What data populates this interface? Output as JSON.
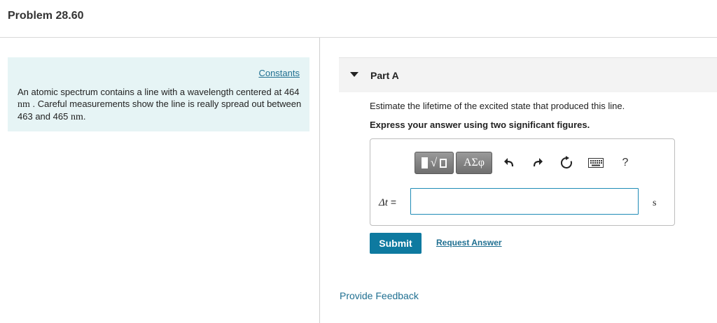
{
  "header": {
    "title": "Problem 28.60"
  },
  "constants": {
    "link": "Constants",
    "text_1": "An atomic spectrum contains a line with a wavelength centered at",
    "value_1": "464",
    "unit_1": "nm",
    "text_2": ". Careful measurements show the line is really spread out between",
    "value_2": "463",
    "text_3": "and",
    "value_3": "465",
    "unit_3": "nm",
    "text_4": "."
  },
  "part": {
    "label": "Part A",
    "question": "Estimate the lifetime of the excited state that produced this line.",
    "instruction": "Express your answer using two significant figures."
  },
  "toolbar": {
    "templates_icon": "templates-icon",
    "greek_label": "ΑΣφ",
    "undo_icon": "undo-icon",
    "redo_icon": "redo-icon",
    "reset_icon": "reset-icon",
    "keyboard_icon": "keyboard-icon",
    "help_label": "?"
  },
  "answer": {
    "variable": "Δt",
    "equals": " =",
    "value": "",
    "unit": "s"
  },
  "actions": {
    "submit": "Submit",
    "request_answer": "Request Answer",
    "feedback": "Provide Feedback"
  },
  "colors": {
    "accent": "#0e7aa0",
    "link": "#1f6f91",
    "constants_bg": "#e6f4f5",
    "input_border": "#1f8bb6"
  }
}
